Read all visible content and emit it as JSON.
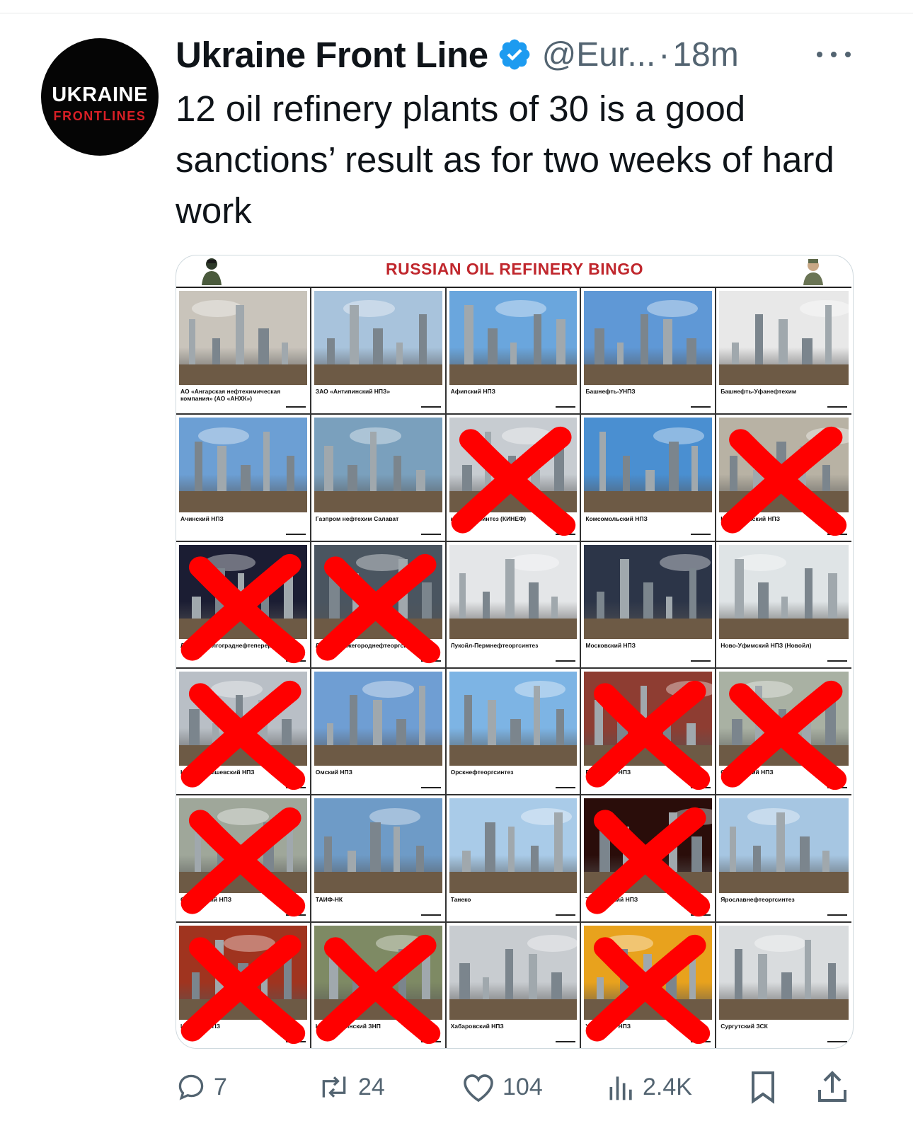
{
  "account": {
    "avatar_line1": "UKRAINE",
    "avatar_line2": "FRONTLINES",
    "display_name": "Ukraine Front Line",
    "handle": "@Eur...",
    "separator": "·",
    "time": "18m",
    "verified_color": "#1d9bf0"
  },
  "tweet": {
    "text": "12 oil refinery plants of 30 is a good sanctions’ result as for two weeks of hard work"
  },
  "media": {
    "title": "RUSSIAN OIL REFINERY BINGO",
    "title_color": "#c0272d",
    "cross_color": "#ff0000",
    "cells": [
      {
        "label": "АО «Ангарская нефтехимическая компания» (АО «АНХК»)",
        "crossed": false,
        "sky": "#c9c4bb"
      },
      {
        "label": "ЗАО «Антипинский НПЗ»",
        "crossed": false,
        "sky": "#a8c3dc"
      },
      {
        "label": "Афипский НПЗ",
        "crossed": false,
        "sky": "#6aa6dd"
      },
      {
        "label": "Башнефть-УНПЗ",
        "crossed": false,
        "sky": "#5f98d6"
      },
      {
        "label": "Башнефть-Уфанефтехим",
        "crossed": false,
        "sky": "#e8e8e8"
      },
      {
        "label": "Ачинский НПЗ",
        "crossed": false,
        "sky": "#6c9fd4"
      },
      {
        "label": "Газпром нефтехим Салават",
        "crossed": false,
        "sky": "#7aa0bd"
      },
      {
        "label": "нефтеоргсинтез (КИНЕФ)",
        "crossed": true,
        "sky": "#c7ccd1"
      },
      {
        "label": "Комсомольский НПЗ",
        "crossed": false,
        "sky": "#4a8fd1"
      },
      {
        "label": "Куйбышевский НПЗ",
        "crossed": true,
        "sky": "#b8b2a4"
      },
      {
        "label": "Лукойл-Волгограднефтепереработка",
        "crossed": true,
        "sky": "#1b1d33"
      },
      {
        "label": "Лукойл-Нижегороднефтеоргсинтез",
        "crossed": true,
        "sky": "#4a5560"
      },
      {
        "label": "Лукойл-Пермнефтеоргсинтез",
        "crossed": false,
        "sky": "#e4e6e8"
      },
      {
        "label": "Московский НПЗ",
        "crossed": false,
        "sky": "#2c3548"
      },
      {
        "label": "Ново-Уфимский НПЗ (Новойл)",
        "crossed": false,
        "sky": "#dfe4e6"
      },
      {
        "label": "Новокуйбышевский НПЗ",
        "crossed": true,
        "sky": "#b9bfc6"
      },
      {
        "label": "Омский НПЗ",
        "crossed": false,
        "sky": "#6f9ed3"
      },
      {
        "label": "Орскнефтеоргсинтез",
        "crossed": false,
        "sky": "#7db4e4"
      },
      {
        "label": "Рязанский НПЗ",
        "crossed": true,
        "sky": "#8e3d32"
      },
      {
        "label": "Саратовский НПЗ",
        "crossed": true,
        "sky": "#a9b1a3"
      },
      {
        "label": "Сызранский НПЗ",
        "crossed": true,
        "sky": "#9fa79a"
      },
      {
        "label": "ТАИФ-НК",
        "crossed": false,
        "sky": "#6e9bc7"
      },
      {
        "label": "Танеко",
        "crossed": false,
        "sky": "#a9cbe8"
      },
      {
        "label": "Туапсинский НПЗ",
        "crossed": true,
        "sky": "#2a0d0a"
      },
      {
        "label": "Ярославнефтеоргсинтез",
        "crossed": false,
        "sky": "#a6c6e2"
      },
      {
        "label": "Ильский НПЗ",
        "crossed": true,
        "sky": "#a0341f"
      },
      {
        "label": "Новошахтинский ЗНП",
        "crossed": true,
        "sky": "#7e8a64"
      },
      {
        "label": "Хабаровский НПЗ",
        "crossed": false,
        "sky": "#c8ccd0"
      },
      {
        "label": "Ухтинский НПЗ",
        "crossed": true,
        "sky": "#e8a21d"
      },
      {
        "label": "Сургутский ЗСК",
        "crossed": false,
        "sky": "#d9dcde"
      }
    ]
  },
  "actions": {
    "replies": "7",
    "reposts": "24",
    "likes": "104",
    "views": "2.4K",
    "icon_color": "#536471"
  }
}
